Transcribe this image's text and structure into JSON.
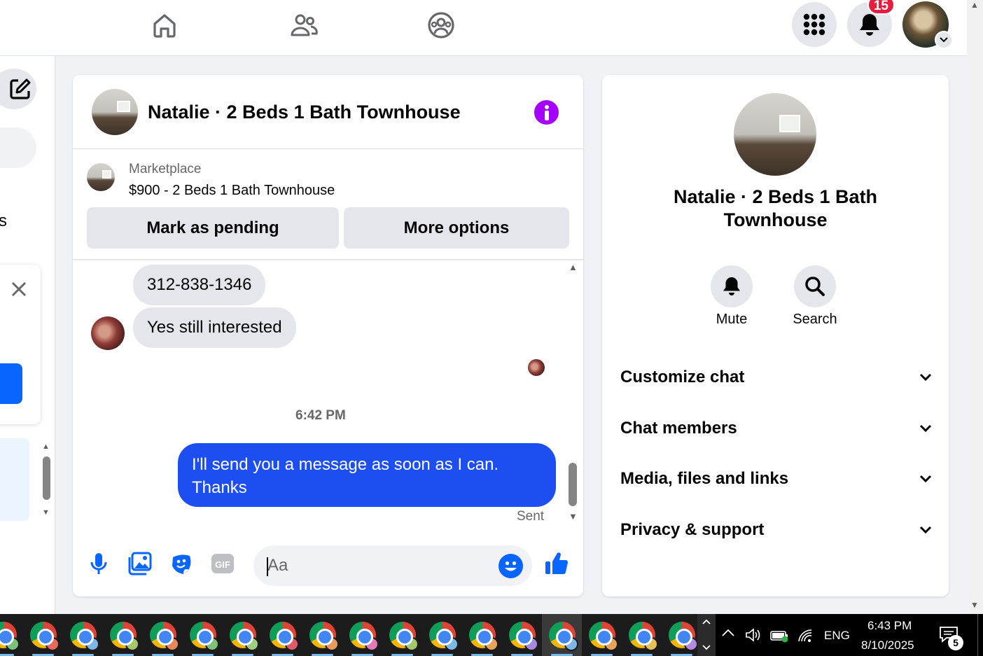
{
  "notifications": {
    "badge_count": "15"
  },
  "chat": {
    "title": "Natalie · 2 Beds 1 Bath Townhouse",
    "listing": {
      "label": "Marketplace",
      "price_title": "$900 - 2 Beds 1 Bath Townhouse",
      "mark_pending_label": "Mark as pending",
      "more_options_label": "More options"
    },
    "messages": {
      "incoming": [
        "312-838-1346",
        "Yes still interested"
      ],
      "timestamp": "6:42 PM",
      "outgoing": "I'll send you a message as soon as I can. Thanks",
      "status": "Sent"
    },
    "composer": {
      "placeholder": "Aa"
    }
  },
  "info_panel": {
    "title": "Natalie · 2 Beds 1 Bath Townhouse",
    "actions": {
      "mute": "Mute",
      "search": "Search"
    },
    "sections": [
      "Customize chat",
      "Chat members",
      "Media, files and links",
      "Privacy & support"
    ]
  },
  "taskbar": {
    "language": "ENG",
    "time": "6:43 PM",
    "date": "8/10/2025",
    "notification_count": "5",
    "chrome_profiles": [
      "#7cc27a",
      "#e86a5a",
      "#7fb8e8",
      "#a5c86a",
      "#e8875a",
      "#7cc27a",
      "#9fcf7a",
      "#e05a6a",
      "#e89a5a",
      "#e07ab8",
      "#a5c86a",
      "#7fb8e8",
      "#e8a55a",
      "#a58ae0",
      "#7fb8e8",
      "#e8a55a",
      "#e8c05a",
      "#b48ae0"
    ]
  },
  "colors": {
    "accent": "#0866ff",
    "outgoing_bubble": "#1d4ef2",
    "info_icon": "#a300ff",
    "badge": "#e41e3f"
  }
}
